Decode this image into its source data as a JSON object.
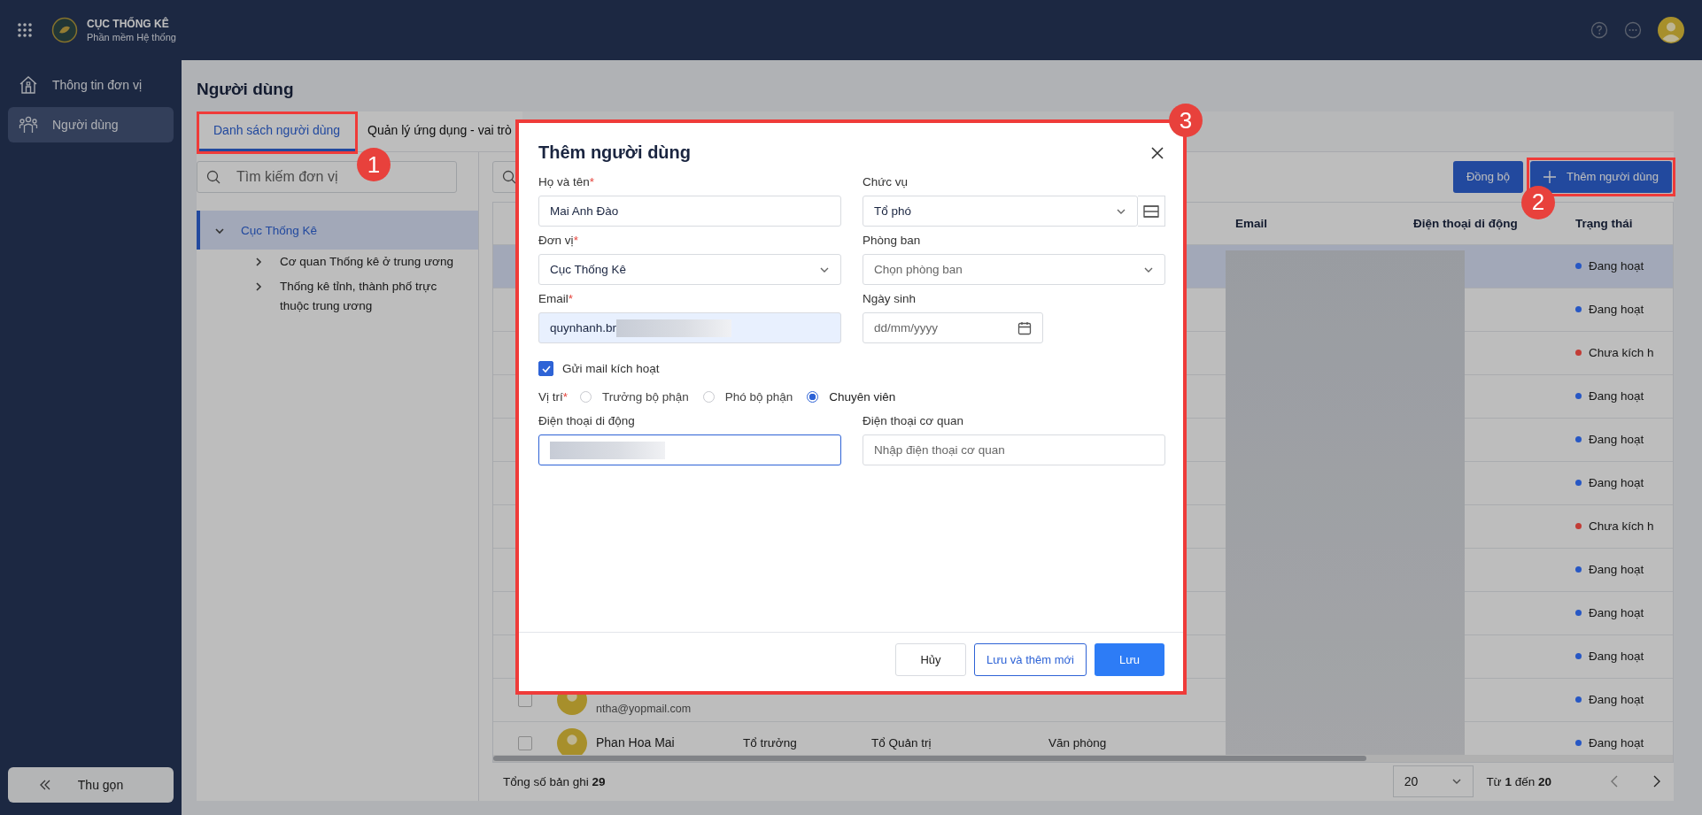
{
  "header": {
    "org": "CỤC THỐNG KÊ",
    "app": "Phần mềm Hệ thống"
  },
  "sidebar": {
    "items": [
      {
        "label": "Thông tin đơn vị",
        "selected": false
      },
      {
        "label": "Người dùng",
        "selected": true
      }
    ],
    "collapse": "Thu gọn"
  },
  "page": {
    "title": "Người dùng"
  },
  "tabs": [
    {
      "label": "Danh sách người dùng",
      "selected": true
    },
    {
      "label": "Quản lý ứng dụng - vai trò",
      "selected": false
    }
  ],
  "unit_search": {
    "placeholder": "Tìm kiếm đơn vị"
  },
  "tree": [
    {
      "label": "Cục Thống Kê",
      "expanded": true,
      "selected": true,
      "children": [
        {
          "label": "Cơ quan Thống kê ở trung ương",
          "expanded": false,
          "selected": false
        },
        {
          "label": "Thống kê tỉnh, thành phố trực thuộc trung ương",
          "expanded": false,
          "selected": false
        }
      ]
    }
  ],
  "toolbar": {
    "buttons": [
      {
        "label": "Đồng bộ",
        "kind": "plain"
      },
      {
        "label": "Thêm người dùng",
        "kind": "add"
      }
    ]
  },
  "table": {
    "columns": [
      "Email",
      "Điện thoại di động",
      "Trạng thái"
    ],
    "rows": [
      {
        "selected": true,
        "status": "Đang hoạt",
        "color": "#2757c4"
      },
      {
        "selected": false,
        "status": "Đang hoạt",
        "color": "#2757c4"
      },
      {
        "selected": false,
        "status": "Chưa kích h",
        "color": "#c23c36"
      },
      {
        "selected": false,
        "status": "Đang hoạt",
        "color": "#2757c4"
      },
      {
        "selected": false,
        "status": "Đang hoạt",
        "color": "#2757c4"
      },
      {
        "selected": false,
        "status": "Đang hoạt",
        "color": "#2757c4"
      },
      {
        "selected": false,
        "status": "Chưa kích h",
        "color": "#c23c36"
      },
      {
        "selected": false,
        "status": "Đang hoạt",
        "color": "#2757c4"
      },
      {
        "selected": false,
        "status": "Đang hoạt",
        "color": "#2757c4"
      },
      {
        "selected": false,
        "status": "Đang hoạt",
        "color": "#2757c4"
      },
      {
        "selected": false,
        "status": "Đang hoạt",
        "color": "#2757c4",
        "email": "ntha@yopmail.com"
      },
      {
        "selected": false,
        "status": "Đang hoạt",
        "color": "#2757c4",
        "name": "Phan Hoa Mai",
        "position": "Tổ trưởng",
        "group": "Tổ Quản trị",
        "department": "Văn phòng"
      }
    ]
  },
  "footer": {
    "total_label": "Tổng số bản ghi",
    "total": "29",
    "page_size": "20",
    "range": "Từ **1** đến **20**"
  },
  "modal": {
    "title": "Thêm người dùng",
    "fields": [
      {
        "label": "Họ và tên",
        "required_mark": "*",
        "kind": "text",
        "value": "Mai Anh Đào",
        "focused": false,
        "autofilled": false,
        "redacted": false
      },
      {
        "label": "Chức vụ",
        "kind": "picklist",
        "value": "Tổ phó",
        "focused": false,
        "autofilled": false,
        "redacted": false
      },
      {
        "label": "Đơn vị",
        "required_mark": "*",
        "kind": "select",
        "value": "Cục Thống Kê",
        "focused": false,
        "autofilled": false,
        "redacted": false
      },
      {
        "label": "Phòng ban",
        "kind": "select",
        "placeholder": "Chọn phòng ban",
        "focused": false,
        "autofilled": false,
        "redacted": false
      },
      {
        "label": "Email",
        "required_mark": "*",
        "kind": "text",
        "value": "quynhanh.br",
        "focused": false,
        "autofilled": true,
        "redacted": true
      },
      {
        "label": "Ngày sinh",
        "kind": "date",
        "placeholder": "dd/mm/yyyy",
        "focused": false,
        "autofilled": false,
        "redacted": false
      }
    ],
    "send_mail": {
      "label": "Gửi mail kích hoạt",
      "checked": true
    },
    "position": {
      "label": "Vị trí",
      "required_mark": "*",
      "options": [
        {
          "label": "Trưởng bộ phận",
          "selected": false
        },
        {
          "label": "Phó bộ phận",
          "selected": false
        },
        {
          "label": "Chuyên viên",
          "selected": true
        }
      ]
    },
    "phone_fields": [
      {
        "label": "Điện thoại di động",
        "kind": "text",
        "focused": true,
        "autofilled": false,
        "redacted": true
      },
      {
        "label": "Điện thoại cơ quan",
        "kind": "text",
        "placeholder": "Nhập điện thoại cơ quan",
        "focused": false,
        "autofilled": false,
        "redacted": false
      }
    ],
    "buttons": [
      {
        "label": "Hủy",
        "kind": "cancel"
      },
      {
        "label": "Lưu và thêm mới",
        "kind": "outline"
      },
      {
        "label": "Lưu",
        "kind": "primary"
      }
    ]
  },
  "annotations": [
    {
      "number": "1"
    },
    {
      "number": "2"
    },
    {
      "number": "3"
    }
  ]
}
